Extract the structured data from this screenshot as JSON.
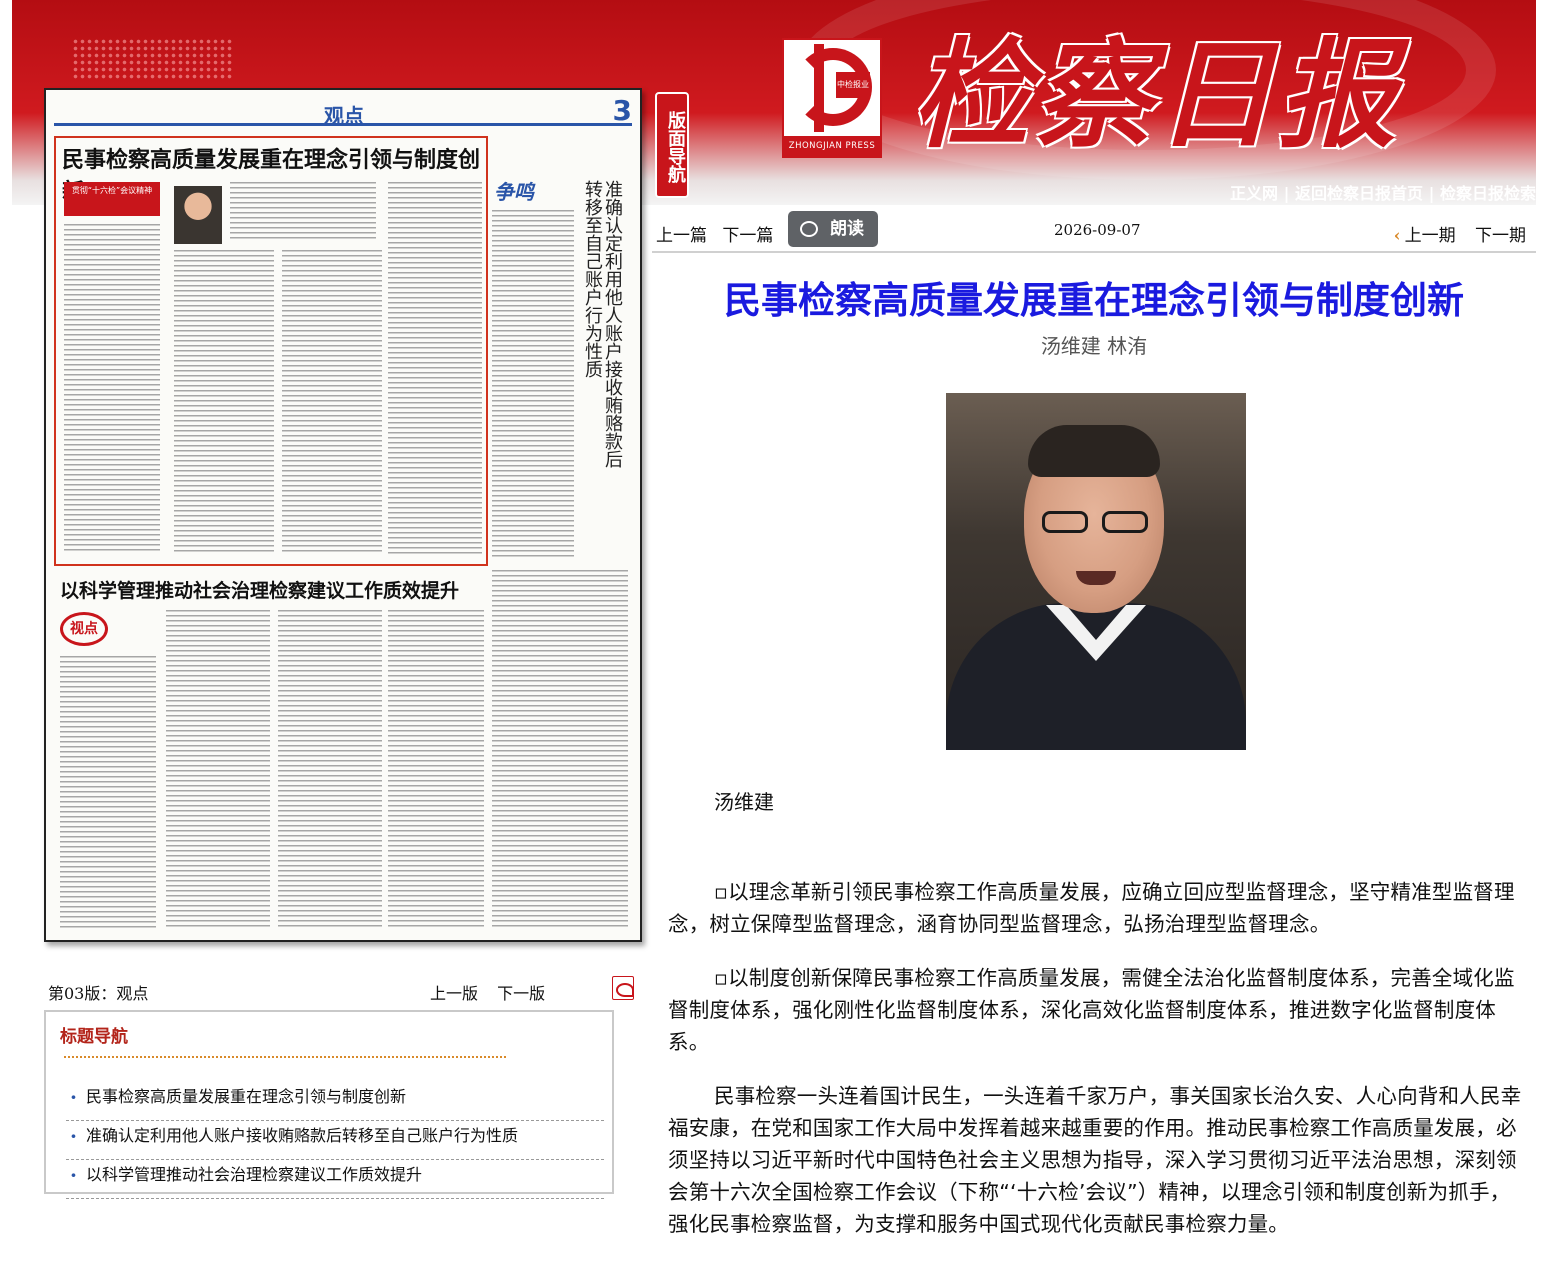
{
  "banner": {
    "masthead": "检察日报",
    "logo_caption": "中检报业",
    "logo_press": "ZHONGJIAN PRESS",
    "links": [
      "正义网",
      "返回检察日报首页",
      "检察日报检索"
    ],
    "side_tab": "版面导航"
  },
  "paper_page": {
    "section": "观点",
    "page_number": "3",
    "headline1": "民事检察高质量发展重在理念引领与制度创新",
    "tag": "贯彻“十六检”会议精神",
    "column": "争鸣",
    "vertical_title": "准确认定利用他人账户接收贿赂款后转移至自己账户行为性质",
    "headline2": "以科学管理推动社会治理检察建议工作质效提升",
    "badge": "视点"
  },
  "page_info": {
    "label": "第03版：观点",
    "prev": "上一版",
    "next": "下一版"
  },
  "title_nav": {
    "heading": "标题导航",
    "items": [
      "民事检察高质量发展重在理念引领与制度创新",
      "准确认定利用他人账户接收贿赂款后转移至自己账户行为性质",
      "以科学管理推动社会治理检察建议工作质效提升"
    ]
  },
  "toolbar": {
    "prev_article": "上一篇",
    "next_article": "下一篇",
    "read_aloud": "朗读",
    "date": "2026-09-07",
    "prev_issue": "上一期",
    "next_issue": "下一期"
  },
  "article": {
    "title": "民事检察高质量发展重在理念引领与制度创新",
    "author": "汤维建 林洧",
    "photo_caption": "汤维建",
    "paragraphs": [
      "▫以理念革新引领民事检察工作高质量发展，应确立回应型监督理念，坚守精准型监督理念，树立保障型监督理念，涵育协同型监督理念，弘扬治理型监督理念。",
      "▫以制度创新保障民事检察工作高质量发展，需健全法治化监督制度体系，完善全域化监督制度体系，强化刚性化监督制度体系，深化高效化监督制度体系，推进数字化监督制度体系。",
      "民事检察一头连着国计民生，一头连着千家万户，事关国家长治久安、人心向背和人民幸福安康，在党和国家工作大局中发挥着越来越重要的作用。推动民事检察工作高质量发展，必须坚持以习近平新时代中国特色社会主义思想为指导，深入学习贯彻习近平法治思想，深刻领会第十六次全国检察工作会议（下称“‘十六检’会议”）精神，以理念引领和制度创新为抓手，强化民事检察监督，为支撑和服务中国式现代化贡献民事检察力量。"
    ]
  }
}
